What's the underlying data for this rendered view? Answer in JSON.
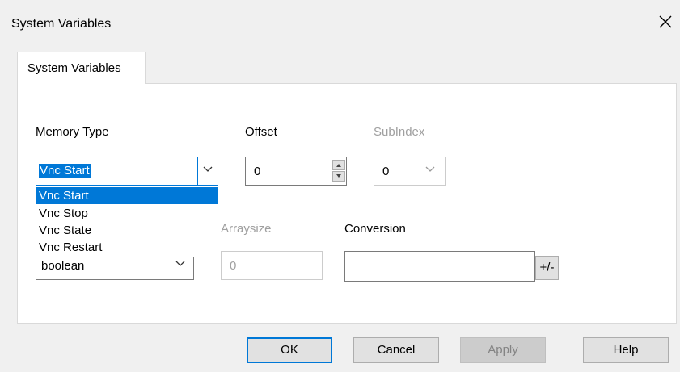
{
  "window": {
    "title": "System Variables",
    "close_icon": "close-icon"
  },
  "tabs": [
    {
      "label": "System Variables",
      "active": true
    }
  ],
  "memory_type": {
    "label": "Memory Type",
    "value": "Vnc Start",
    "options": [
      "Vnc Start",
      "Vnc Stop",
      "Vnc State",
      "Vnc Restart"
    ],
    "selected_option": "Vnc Start"
  },
  "offset": {
    "label": "Offset",
    "value": "0"
  },
  "subindex": {
    "label": "SubIndex",
    "value": "0",
    "disabled": true
  },
  "data_type": {
    "value": "boolean"
  },
  "arraysize": {
    "label": "Arraysize",
    "value": "0",
    "disabled": true
  },
  "conversion": {
    "label": "Conversion",
    "value": "",
    "toggle_label": "+/-"
  },
  "buttons": {
    "ok": "OK",
    "cancel": "Cancel",
    "apply": "Apply",
    "help": "Help"
  },
  "colors": {
    "accent": "#0078d7",
    "disabled_text": "#a0a0a0",
    "panel": "#ffffff",
    "dialog": "#f0f0f0"
  }
}
